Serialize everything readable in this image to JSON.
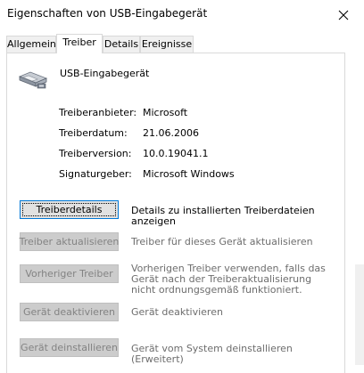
{
  "window": {
    "title": "Eigenschaften von USB-Eingabegerät",
    "close_icon": "close-icon"
  },
  "tabs": [
    {
      "label": "Allgemein"
    },
    {
      "label": "Treiber"
    },
    {
      "label": "Details"
    },
    {
      "label": "Ereignisse"
    }
  ],
  "active_tab": "Treiber",
  "device": {
    "icon": "usb-device-icon",
    "name": "USB-Eingabegerät"
  },
  "driver_info": [
    {
      "label": "Treiberanbieter:",
      "value": "Microsoft"
    },
    {
      "label": "Treiberdatum:",
      "value": "21.06.2006"
    },
    {
      "label": "Treiberversion:",
      "value": "10.0.19041.1"
    },
    {
      "label": "Signaturgeber:",
      "value": "Microsoft Windows"
    }
  ],
  "actions": [
    {
      "button": "Treiberdetails",
      "description": "Details zu installierten Treiberdateien anzeigen",
      "enabled": true
    },
    {
      "button": "Treiber aktualisieren",
      "description": "Treiber für dieses Gerät aktualisieren",
      "enabled": false
    },
    {
      "button": "Vorheriger Treiber",
      "description": "Vorherigen Treiber verwenden, falls das Gerät nach der Treiberaktualisierung nicht ordnungsgemäß funktioniert.",
      "enabled": false
    },
    {
      "button": "Gerät deaktivieren",
      "description": "Gerät deaktivieren",
      "enabled": false
    },
    {
      "button": "Gerät deinstallieren",
      "description": "Gerät vom System deinstallieren (Erweitert)",
      "enabled": false
    }
  ],
  "colors": {
    "focus_border": "#0078d7",
    "disabled_button": "#cccccc",
    "disabled_text": "#838383"
  }
}
